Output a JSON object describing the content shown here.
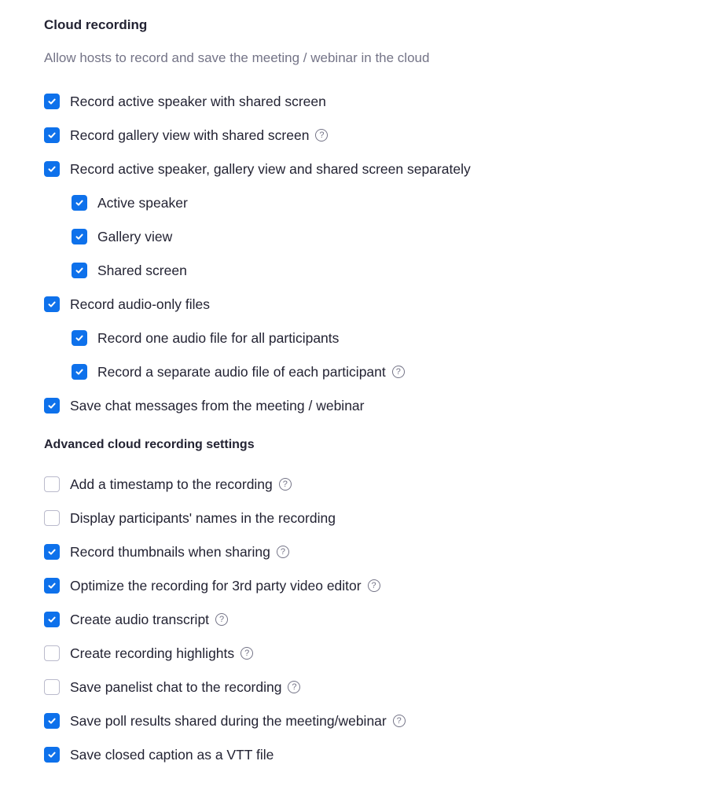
{
  "cloud": {
    "title": "Cloud recording",
    "description": "Allow hosts to record and save the meeting / webinar in the cloud",
    "options": [
      {
        "label": "Record active speaker with shared screen",
        "checked": true,
        "help": false,
        "indent": 0
      },
      {
        "label": "Record gallery view with shared screen",
        "checked": true,
        "help": true,
        "indent": 0
      },
      {
        "label": "Record active speaker, gallery view and shared screen separately",
        "checked": true,
        "help": false,
        "indent": 0
      },
      {
        "label": "Active speaker",
        "checked": true,
        "help": false,
        "indent": 1
      },
      {
        "label": "Gallery view",
        "checked": true,
        "help": false,
        "indent": 1
      },
      {
        "label": "Shared screen",
        "checked": true,
        "help": false,
        "indent": 1
      },
      {
        "label": "Record audio-only files",
        "checked": true,
        "help": false,
        "indent": 0
      },
      {
        "label": "Record one audio file for all participants",
        "checked": true,
        "help": false,
        "indent": 1
      },
      {
        "label": "Record a separate audio file of each participant",
        "checked": true,
        "help": true,
        "indent": 1
      },
      {
        "label": "Save chat messages from the meeting / webinar",
        "checked": true,
        "help": false,
        "indent": 0
      }
    ]
  },
  "advanced": {
    "title": "Advanced cloud recording settings",
    "options": [
      {
        "label": "Add a timestamp to the recording",
        "checked": false,
        "help": true
      },
      {
        "label": "Display participants' names in the recording",
        "checked": false,
        "help": false
      },
      {
        "label": "Record thumbnails when sharing",
        "checked": true,
        "help": true
      },
      {
        "label": "Optimize the recording for 3rd party video editor",
        "checked": true,
        "help": true
      },
      {
        "label": "Create audio transcript",
        "checked": true,
        "help": true
      },
      {
        "label": "Create recording highlights",
        "checked": false,
        "help": true
      },
      {
        "label": "Save panelist chat to the recording",
        "checked": false,
        "help": true
      },
      {
        "label": "Save poll results shared during the meeting/webinar",
        "checked": true,
        "help": true
      },
      {
        "label": "Save closed caption as a VTT file",
        "checked": true,
        "help": false
      }
    ]
  },
  "icons": {
    "help_glyph": "?",
    "check": "check-icon"
  },
  "colors": {
    "accent": "#0e71eb",
    "text": "#232333",
    "muted": "#747487",
    "unchecked_border": "#babacc"
  }
}
